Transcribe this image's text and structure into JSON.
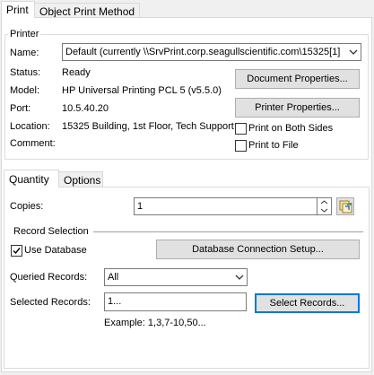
{
  "tabs": {
    "print": "Print",
    "object_print_method": "Object Print Method"
  },
  "printer": {
    "group_title": "Printer",
    "name_label": "Name:",
    "name_value": "Default (currently \\\\SrvPrint.corp.seagullscientific.com\\15325[1]",
    "status_label": "Status:",
    "status_value": "Ready",
    "model_label": "Model:",
    "model_value": "HP Universal Printing PCL 5 (v5.5.0)",
    "port_label": "Port:",
    "port_value": "10.5.40.20",
    "location_label": "Location:",
    "location_value": "15325 Building, 1st Floor, Tech Support",
    "comment_label": "Comment:",
    "document_properties": "Document Properties...",
    "printer_properties": "Printer Properties...",
    "print_both_sides": "Print on Both Sides",
    "print_to_file": "Print to File"
  },
  "subtabs": {
    "quantity": "Quantity",
    "options": "Options"
  },
  "quantity": {
    "copies_label": "Copies:",
    "copies_value": "1",
    "record_selection_title": "Record Selection",
    "use_database": "Use Database",
    "db_connection_button": "Database Connection Setup...",
    "queried_records_label": "Queried Records:",
    "queried_records_value": "All",
    "selected_records_label": "Selected Records:",
    "selected_records_value": "1...",
    "select_records_button": "Select Records...",
    "example_text": "Example: 1,3,7-10,50..."
  },
  "state": {
    "use_database_checked": true,
    "print_both_sides_checked": false,
    "print_to_file_checked": false
  },
  "colors": {
    "focus_border": "#0078d7",
    "button_face": "#e1e1e1",
    "window_bg": "#f0f0f0"
  }
}
